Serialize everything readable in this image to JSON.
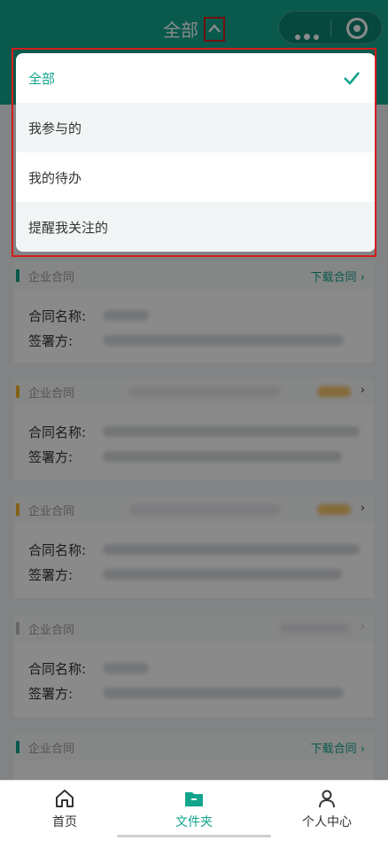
{
  "header": {
    "title": "全部",
    "chevron_icon": "chevron-up-icon",
    "more_icon": "more-dots-icon",
    "close_icon": "target-icon",
    "color": "#12a48d"
  },
  "dropdown": {
    "items": [
      {
        "label": "全部",
        "selected": true
      },
      {
        "label": "我参与的",
        "selected": false
      },
      {
        "label": "我的待办",
        "selected": false
      },
      {
        "label": "提醒我关注的",
        "selected": false
      }
    ],
    "selected_icon": "check-icon"
  },
  "cards": [
    {
      "type": "企业合同",
      "action": "下载合同",
      "status_color": "#12a48d",
      "name_label": "合同名称:",
      "party_label": "签署方:"
    },
    {
      "type": "企业合同",
      "action": "",
      "status_color": "#f2b52d",
      "name_label": "合同名称:",
      "party_label": "签署方:"
    },
    {
      "type": "企业合同",
      "action": "",
      "status_color": "#f2b52d",
      "name_label": "合同名称:",
      "party_label": "签署方:"
    },
    {
      "type": "企业合同",
      "action": "",
      "status_color": "#bfbfbf",
      "name_label": "合同名称:",
      "party_label": "签署方:"
    },
    {
      "type": "企业合同",
      "action": "下载合同",
      "status_color": "#12a48d"
    }
  ],
  "tabbar": {
    "items": [
      {
        "label": "首页",
        "icon": "home-icon",
        "active": false
      },
      {
        "label": "文件夹",
        "icon": "folder-icon",
        "active": true
      },
      {
        "label": "个人中心",
        "icon": "person-icon",
        "active": false
      }
    ]
  }
}
